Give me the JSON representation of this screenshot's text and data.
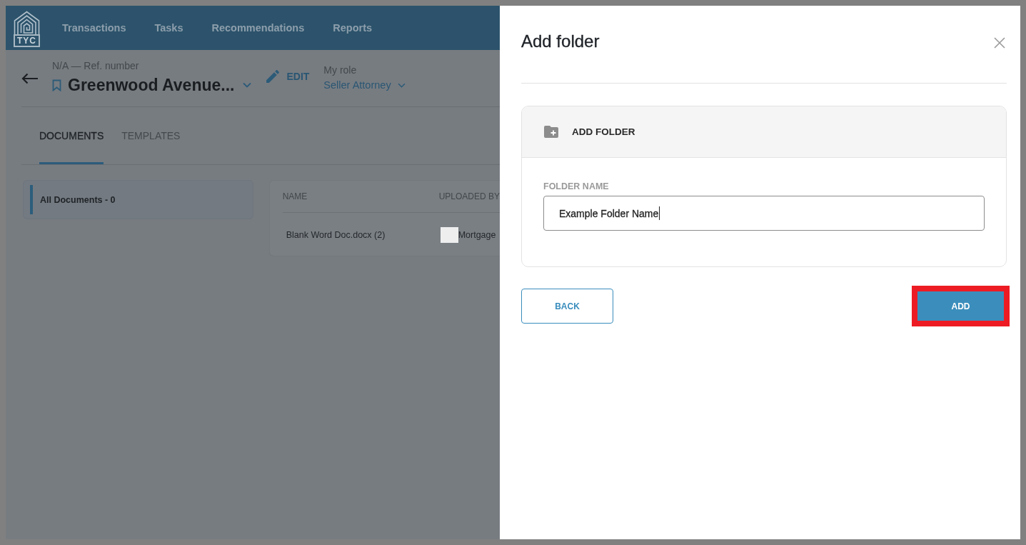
{
  "header": {
    "logo_text": "TYC",
    "nav": [
      {
        "label": "Transactions"
      },
      {
        "label": "Tasks"
      },
      {
        "label": "Recommendations"
      },
      {
        "label": "Reports"
      }
    ]
  },
  "transaction": {
    "reference": "N/A — Ref. number",
    "title": "Greenwood Avenue...",
    "edit_label": "EDIT",
    "role_label": "My role",
    "role": "Seller Attorney"
  },
  "tabs": [
    {
      "label": "DOCUMENTS",
      "selected": true
    },
    {
      "label": "TEMPLATES",
      "selected": false
    }
  ],
  "folders": [
    {
      "label": "All Documents - 0",
      "selected": true
    }
  ],
  "documents_table": {
    "columns": [
      "NAME",
      "UPLOADED BY"
    ],
    "rows": [
      {
        "name": "Blank Word Doc.docx (2)",
        "uploaded_by": "Mortgage"
      }
    ]
  },
  "drawer": {
    "title": "Add folder",
    "section_title": "ADD FOLDER",
    "field": {
      "label": "FOLDER NAME",
      "value": "Example Folder Name"
    },
    "buttons": [
      {
        "label": "BACK",
        "kind": "secondary",
        "highlighted": false
      },
      {
        "label": "ADD",
        "kind": "primary",
        "highlighted": true
      }
    ]
  }
}
